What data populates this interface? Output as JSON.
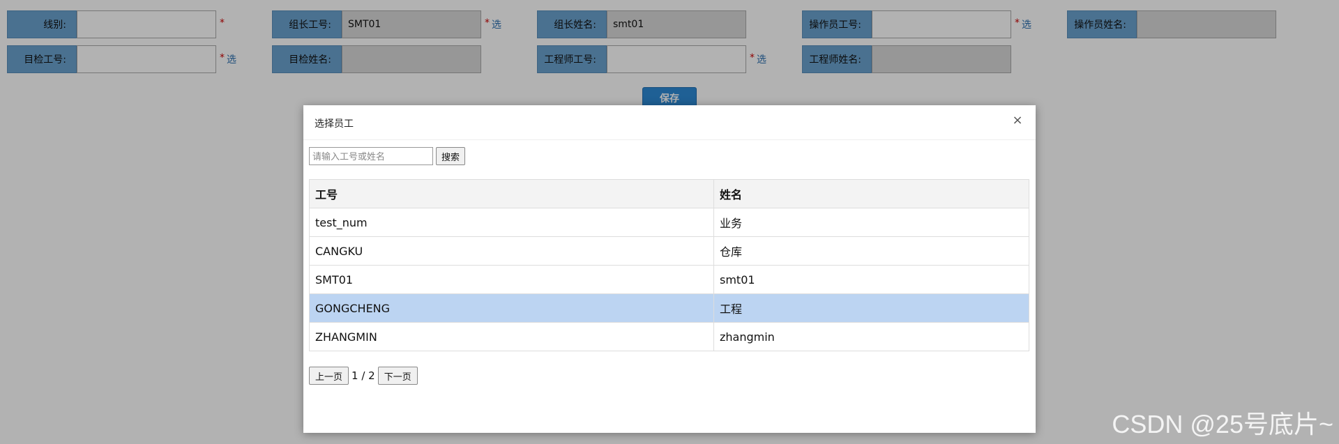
{
  "form": {
    "row1": [
      {
        "label": "线别:",
        "value": "",
        "required": "*",
        "select": ""
      },
      {
        "label": "组长工号:",
        "value": "SMT01",
        "required": "*",
        "select": "选"
      },
      {
        "label": "组长姓名:",
        "value": "smt01",
        "required": "",
        "select": ""
      },
      {
        "label": "操作员工号:",
        "value": "",
        "required": "*",
        "select": "选"
      },
      {
        "label": "操作员姓名:",
        "value": "",
        "required": "",
        "select": ""
      }
    ],
    "row2": [
      {
        "label": "目检工号:",
        "value": "",
        "required": "*",
        "select": "选"
      },
      {
        "label": "目检姓名:",
        "value": "",
        "required": "",
        "select": ""
      },
      {
        "label": "工程师工号:",
        "value": "",
        "required": "*",
        "select": "选"
      },
      {
        "label": "工程师姓名:",
        "value": "",
        "required": "",
        "select": ""
      }
    ],
    "save_label": "保存"
  },
  "modal": {
    "title": "选择员工",
    "close_icon": "×",
    "search_placeholder": "请输入工号或姓名",
    "search_label": "搜索",
    "columns": [
      "工号",
      "姓名"
    ],
    "rows": [
      {
        "id": "test_num",
        "name": "业务"
      },
      {
        "id": "CANGKU",
        "name": "仓库"
      },
      {
        "id": "SMT01",
        "name": "smt01"
      },
      {
        "id": "GONGCHENG",
        "name": "工程"
      },
      {
        "id": "ZHANGMIN",
        "name": "zhangmin"
      }
    ],
    "pager": {
      "prev_label": "上一页",
      "page_text": "1 / 2",
      "next_label": "下一页"
    }
  },
  "watermark": "CSDN @25号底片~"
}
